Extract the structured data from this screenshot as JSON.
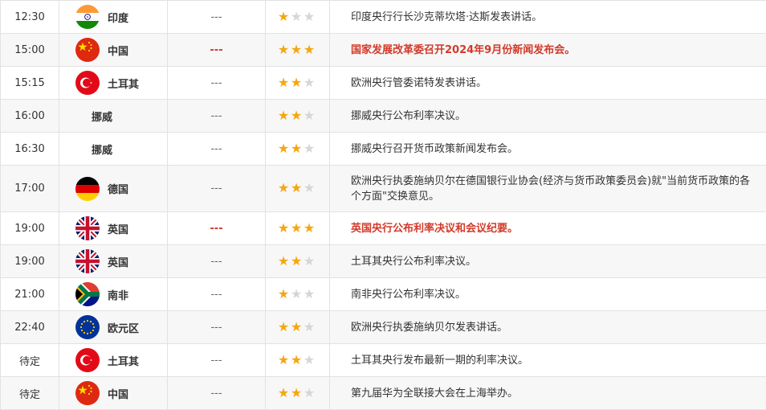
{
  "rows": [
    {
      "time": "12:30",
      "flag": "india-flag",
      "country": "印度",
      "dash": "---",
      "stars": 1,
      "desc": "印度央行行长沙克蒂坎塔·达斯发表讲话。",
      "highlight": false
    },
    {
      "time": "15:00",
      "flag": "china-flag",
      "country": "中国",
      "dash": "---",
      "stars": 3,
      "desc": "国家发展改革委召开2024年9月份新闻发布会。",
      "highlight": true
    },
    {
      "time": "15:15",
      "flag": "turkey-flag",
      "country": "土耳其",
      "dash": "---",
      "stars": 2,
      "desc": "欧洲央行管委诺特发表讲话。",
      "highlight": false
    },
    {
      "time": "16:00",
      "flag": "",
      "country": "挪威",
      "dash": "---",
      "stars": 2,
      "desc": "挪威央行公布利率决议。",
      "highlight": false
    },
    {
      "time": "16:30",
      "flag": "",
      "country": "挪威",
      "dash": "---",
      "stars": 2,
      "desc": "挪威央行召开货币政策新闻发布会。",
      "highlight": false
    },
    {
      "time": "17:00",
      "flag": "germany-flag",
      "country": "德国",
      "dash": "---",
      "stars": 2,
      "desc": "欧洲央行执委施纳贝尔在德国银行业协会(经济与货币政策委员会)就\"当前货币政策的各个方面\"交换意见。",
      "highlight": false
    },
    {
      "time": "19:00",
      "flag": "uk-flag",
      "country": "英国",
      "dash": "---",
      "stars": 3,
      "desc": "英国央行公布利率决议和会议纪要。",
      "highlight": true
    },
    {
      "time": "19:00",
      "flag": "uk-flag",
      "country": "英国",
      "dash": "---",
      "stars": 2,
      "desc": "土耳其央行公布利率决议。",
      "highlight": false
    },
    {
      "time": "21:00",
      "flag": "south-africa-flag",
      "country": "南非",
      "dash": "---",
      "stars": 1,
      "desc": "南非央行公布利率决议。",
      "highlight": false
    },
    {
      "time": "22:40",
      "flag": "eu-flag",
      "country": "欧元区",
      "dash": "---",
      "stars": 2,
      "desc": "欧洲央行执委施纳贝尔发表讲话。",
      "highlight": false
    },
    {
      "time": "待定",
      "flag": "turkey-flag",
      "country": "土耳其",
      "dash": "---",
      "stars": 2,
      "desc": "土耳其央行发布最新一期的利率决议。",
      "highlight": false
    },
    {
      "time": "待定",
      "flag": "china-flag",
      "country": "中国",
      "dash": "---",
      "stars": 2,
      "desc": "第九届华为全联接大会在上海举办。",
      "highlight": false
    }
  ],
  "max_stars": 3,
  "colors": {
    "highlight": "#d23a2a",
    "star_on": "#f6a60f",
    "star_off": "#d6d6d6",
    "border": "#e2e2e2",
    "row_alt": "#f7f7f7"
  }
}
